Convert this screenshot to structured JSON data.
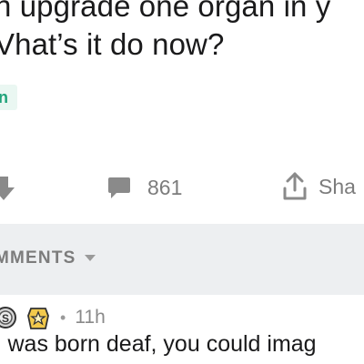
{
  "post": {
    "title_line1": "n upgrade one organ in y",
    "title_line2": "Vhat’s it do now?",
    "flair": "n"
  },
  "actions": {
    "comment_count": "861",
    "share_label": "Sha"
  },
  "comments_section": {
    "header_label": "MMENTS"
  },
  "comment": {
    "badge_letter": "S",
    "time": "11h",
    "separator": "•",
    "body": "i was born deaf, you could imag"
  },
  "colors": {
    "flair_bg": "#eaf7f2",
    "flair_text": "#1fa37a",
    "header_band": "#edeff1",
    "icon_gray": "#8a8a8a"
  }
}
